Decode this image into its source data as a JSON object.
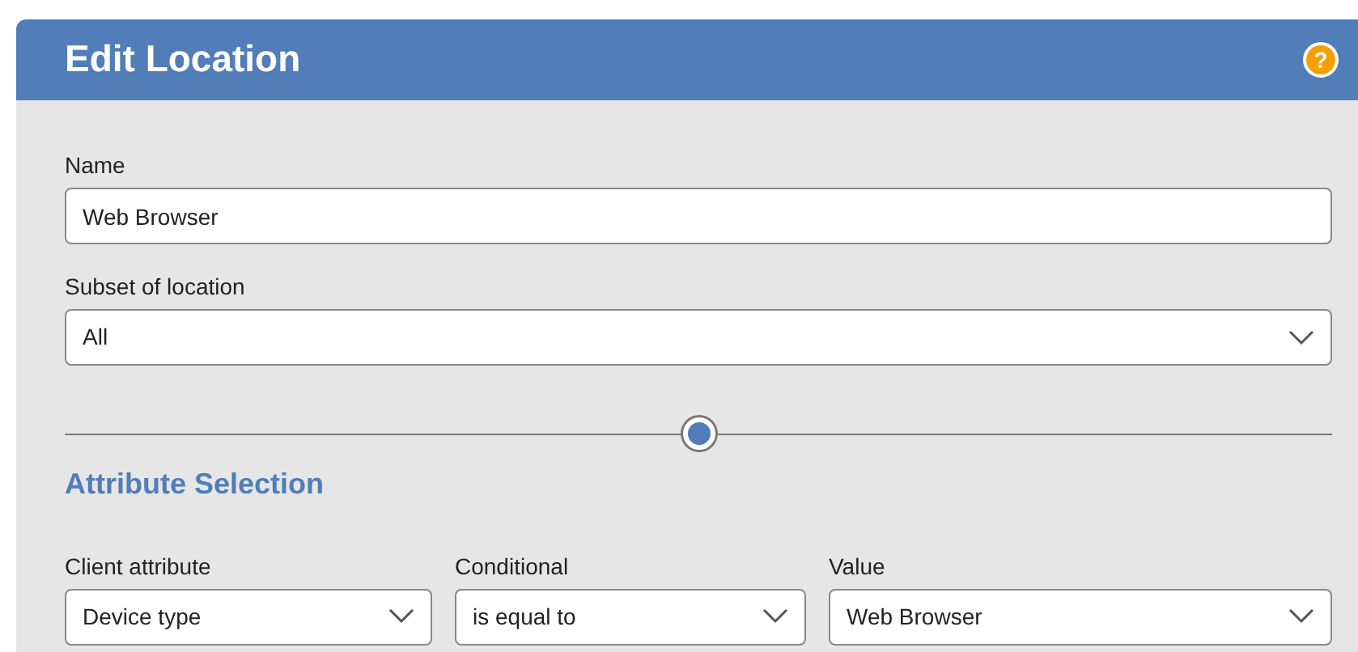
{
  "header": {
    "title": "Edit Location",
    "help_icon": "?"
  },
  "name_field": {
    "label": "Name",
    "value": "Web Browser"
  },
  "subset_field": {
    "label": "Subset of location",
    "value": "All"
  },
  "section_title": "Attribute Selection",
  "attribute_fields": [
    {
      "label": "Client attribute",
      "value": "Device type"
    },
    {
      "label": "Conditional",
      "value": "is equal to"
    },
    {
      "label": "Value",
      "value": "Web Browser"
    }
  ]
}
